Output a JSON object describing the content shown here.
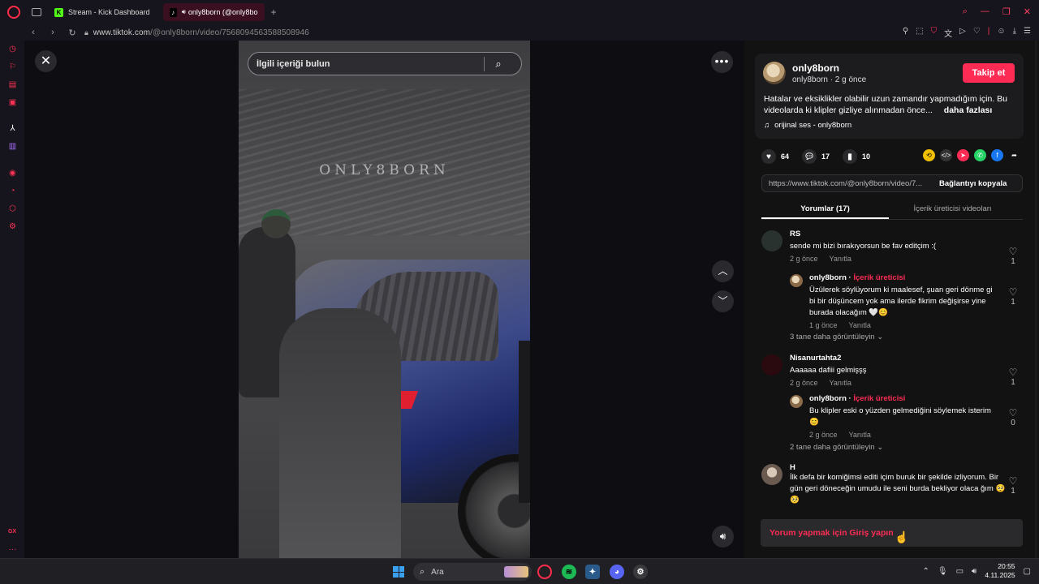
{
  "browser": {
    "tabs": [
      {
        "label": "Stream - Kick Dashboard",
        "icon": "kick-icon"
      },
      {
        "label": "only8born (@only8bo",
        "icon": "tiktok-icon",
        "active": true
      }
    ],
    "url_host": "www.tiktok.com",
    "url_path": "/@only8born/video/7568094563588508946"
  },
  "video": {
    "search_placeholder": "İlgili içeriği bulun",
    "watermark": "ONLY8BORN"
  },
  "post": {
    "username": "only8born",
    "meta": "only8born · 2 g önce",
    "follow_label": "Takip et",
    "description": "Hatalar ve eksiklikler olabilir uzun zamandır yapmadığım için. Bu videolarda ki klipler gizliye alınmadan önce...",
    "more_label": "daha fazlası",
    "music": "orijinal ses - only8born",
    "likes": "64",
    "comments": "17",
    "saves": "10",
    "link": "https://www.tiktok.com/@only8born/video/7...",
    "copy_label": "Bağlantıyı kopyala",
    "tab_comments": "Yorumlar (17)",
    "tab_creator_videos": "İçerik üreticisi videoları"
  },
  "comments": [
    {
      "name": "RS",
      "text": "sende mi bizi bırakıyorsun be fav editçim :(",
      "time": "2 g önce",
      "reply": "Yanıtla",
      "likes": "1"
    },
    {
      "name": "only8born",
      "badge": "İçerik üreticisi",
      "text": "Üzülerek söylüyorum ki maalesef, şuan geri dönme gi bi bir düşüncem yok ama ilerde fikrim değişirse yine burada olacağım 🤍😊",
      "time": "1 g önce",
      "reply": "Yanıtla",
      "likes": "1"
    },
    {
      "view_more": "3 tane daha görüntüleyin"
    },
    {
      "name": "Nisanurtahta2",
      "text": "Aaaaaa dafiii gelmişşş",
      "time": "2 g önce",
      "reply": "Yanıtla",
      "likes": "1"
    },
    {
      "name": "only8born",
      "badge": "İçerik üreticisi",
      "text": "Bu klipler eski o yüzden gelmediğini söylemek isterim 😊",
      "time": "2 g önce",
      "reply": "Yanıtla",
      "likes": "0"
    },
    {
      "view_more": "2 tane daha görüntüleyin"
    },
    {
      "name": "H",
      "text": "İlk defa bir komiğimsi editi içim buruk bir şekilde izliyorum. Bir gün geri döneceğin umudu ile seni burda bekliyor olaca ğım 🥺🥺",
      "likes": "1"
    }
  ],
  "comment_prompt": "Yorum yapmak için Giriş yapın",
  "taskbar": {
    "search_label": "Ara",
    "time": "20:55",
    "date": "4.11.2025"
  },
  "sidebar": {
    "gx_label": "GX",
    "more_label": "···"
  },
  "colors": {
    "accent": "#fe2c55",
    "opera_red": "#ff2d4a"
  }
}
